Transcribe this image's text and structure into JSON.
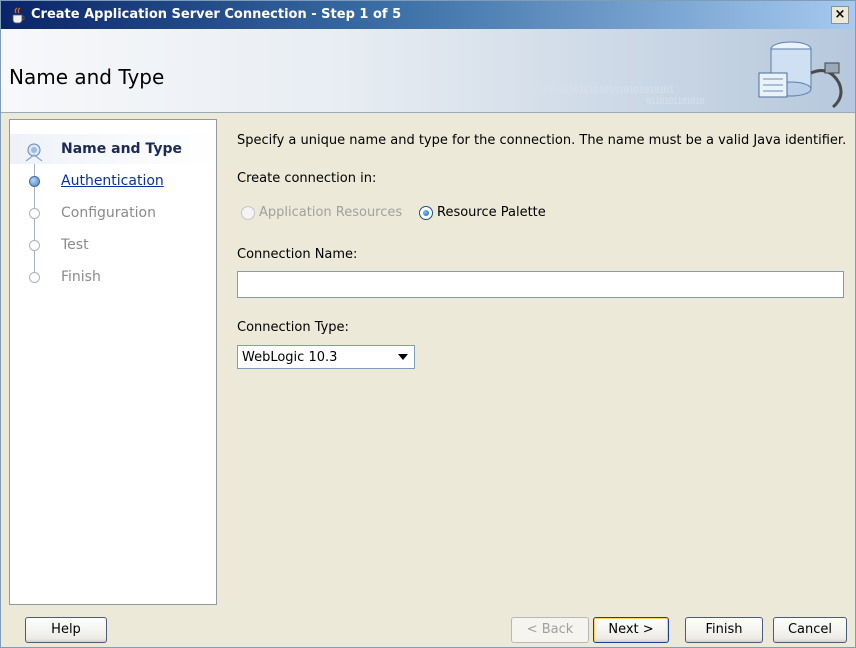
{
  "window": {
    "title": "Create Application Server Connection - Step 1 of 5",
    "close_symbol": "×"
  },
  "header": {
    "page_title": "Name and Type",
    "binary_line1": "0101010101010101010101010101",
    "binary_line2": "0110101101010"
  },
  "nav": {
    "items": [
      {
        "label": "Name and Type",
        "state": "current"
      },
      {
        "label": "Authentication",
        "state": "link"
      },
      {
        "label": "Configuration",
        "state": "disabled"
      },
      {
        "label": "Test",
        "state": "disabled"
      },
      {
        "label": "Finish",
        "state": "disabled"
      }
    ]
  },
  "main": {
    "instructions": "Specify a unique name and type for the connection. The name must be a valid Java identifier.",
    "create_in_label": "Create connection in:",
    "radio_app_resources": {
      "label": "Application Resources",
      "enabled": false,
      "selected": false
    },
    "radio_resource_palette": {
      "label": "Resource Palette",
      "enabled": true,
      "selected": true
    },
    "connection_name_label": "Connection Name:",
    "connection_name_value": "",
    "connection_type_label": "Connection Type:",
    "connection_type_value": "WebLogic 10.3"
  },
  "footer": {
    "help": "Help",
    "back": "< Back",
    "next": "Next >",
    "finish": "Finish",
    "cancel": "Cancel"
  },
  "colors": {
    "titlebar_start": "#0a246a",
    "titlebar_end": "#a6caf0",
    "link": "#0b2fa0",
    "dialog_bg": "#ece9d8"
  },
  "icons": {
    "app": "java-cup-icon",
    "header": "server-connection-icon",
    "close": "close-icon"
  }
}
